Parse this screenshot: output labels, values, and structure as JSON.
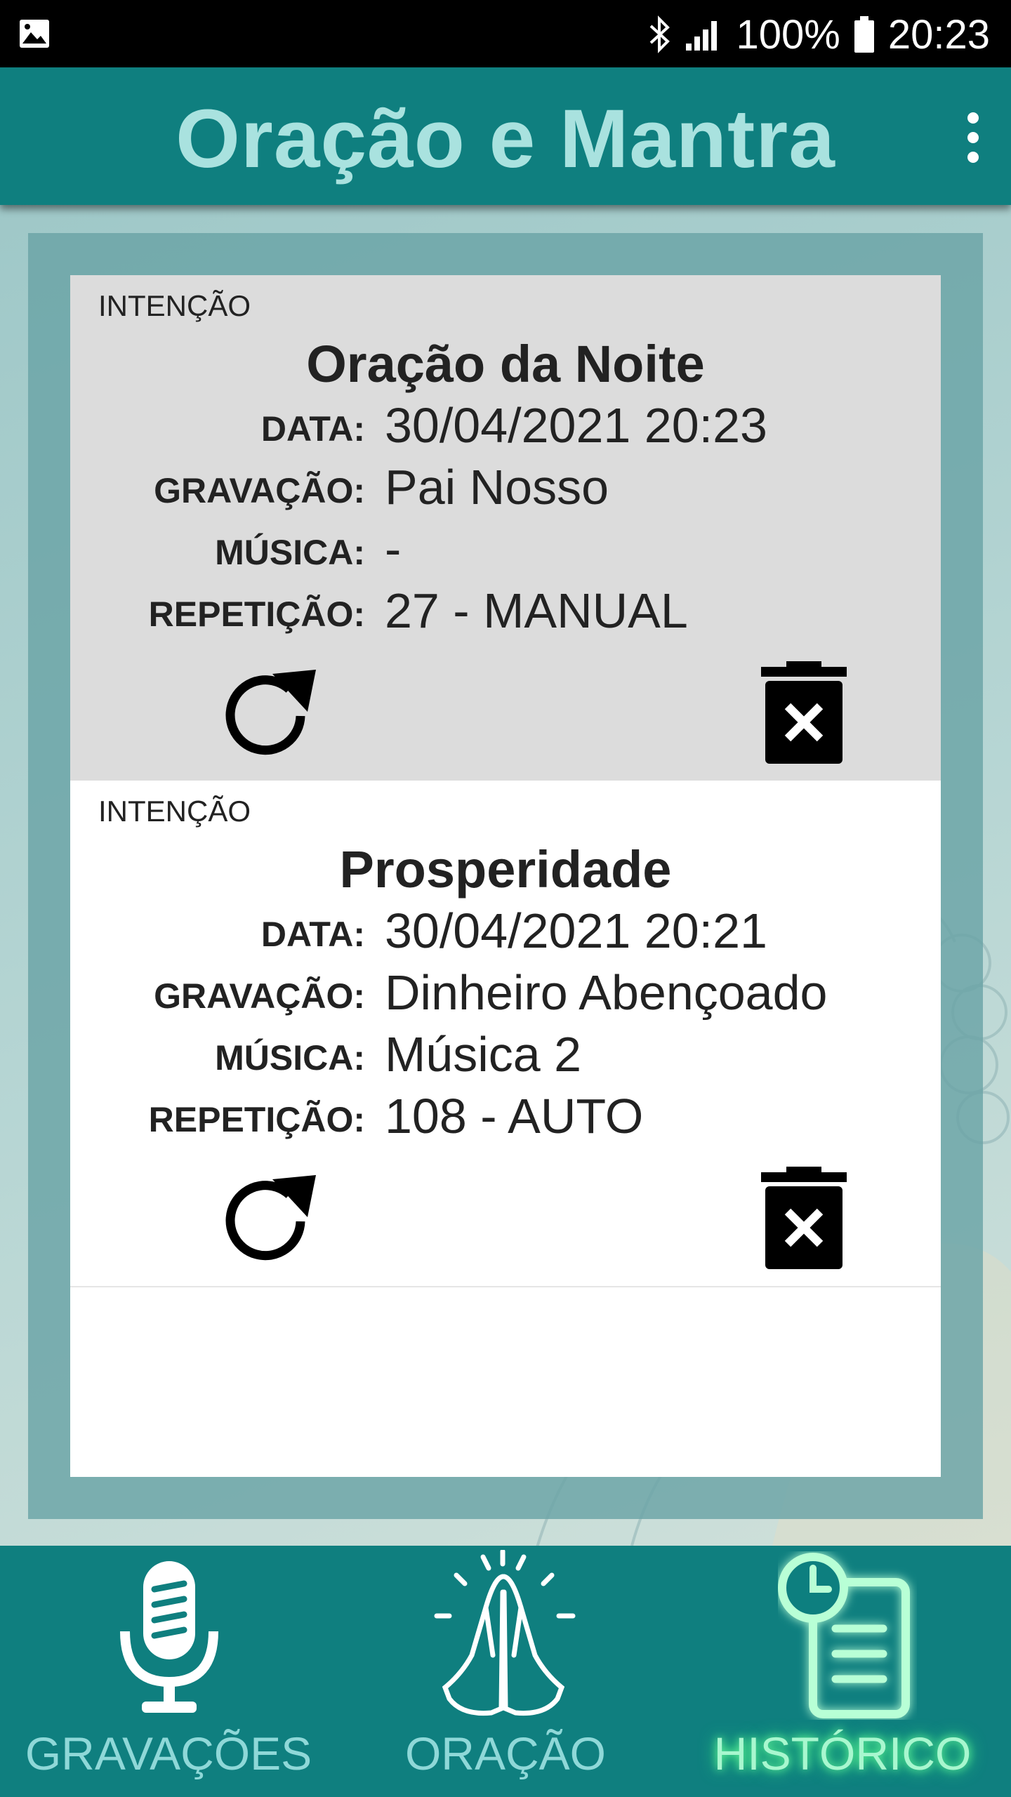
{
  "status_bar": {
    "battery": "100%",
    "time": "20:23",
    "icons": [
      "gallery-icon",
      "bluetooth-icon",
      "signal-icon",
      "battery-icon"
    ]
  },
  "app_bar": {
    "title": "Oração e Mantra",
    "menu_icon": "more-vert-icon"
  },
  "history": [
    {
      "intent_label": "INTENÇÃO",
      "title": "Oração da Noite",
      "fields": [
        {
          "label": "DATA:",
          "value": "30/04/2021 20:23"
        },
        {
          "label": "GRAVAÇÃO:",
          "value": "Pai Nosso"
        },
        {
          "label": "MÚSICA:",
          "value": "-"
        },
        {
          "label": "REPETIÇÃO:",
          "value": "27 -  MANUAL"
        }
      ]
    },
    {
      "intent_label": "INTENÇÃO",
      "title": "Prosperidade",
      "fields": [
        {
          "label": "DATA:",
          "value": "30/04/2021 20:21"
        },
        {
          "label": "GRAVAÇÃO:",
          "value": "Dinheiro Abençoado"
        },
        {
          "label": "MÚSICA:",
          "value": "Música 2"
        },
        {
          "label": "REPETIÇÃO:",
          "value": "108 -  AUTO"
        }
      ]
    }
  ],
  "bottom_nav": {
    "items": [
      {
        "label": "GRAVAÇÕES",
        "icon": "microphone-icon",
        "active": false
      },
      {
        "label": "ORAÇÃO",
        "icon": "praying-hands-icon",
        "active": false
      },
      {
        "label": "HISTÓRICO",
        "icon": "history-document-icon",
        "active": true
      }
    ]
  },
  "colors": {
    "primary": "#0f7f7f",
    "title_text": "#a9e2df",
    "card_highlight": "#dcdcdc",
    "active_nav": "#a8f7cf"
  }
}
